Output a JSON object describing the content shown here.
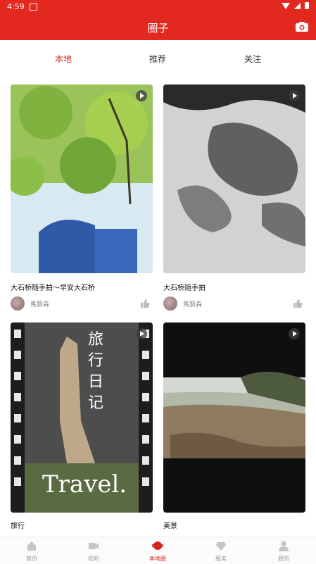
{
  "status": {
    "time": "4:59"
  },
  "appbar": {
    "title": "圈子",
    "camera_icon": "camera-icon"
  },
  "tabs": [
    {
      "label": "本地",
      "active": true
    },
    {
      "label": "推荐",
      "active": false
    },
    {
      "label": "关注",
      "active": false
    }
  ],
  "feed": [
    {
      "title": "大石桥随手拍～早安大石桥",
      "author": "馬賢森"
    },
    {
      "title": "大石桥随手拍",
      "author": "馬賢森"
    },
    {
      "title": "旅行",
      "overlay": "旅 行 日 记",
      "overlay2": "Travel."
    },
    {
      "title": "美景"
    }
  ],
  "bottom_nav": [
    {
      "label": "首页",
      "icon": "home-icon"
    },
    {
      "label": "视听",
      "icon": "video-icon"
    },
    {
      "label": "本地圈",
      "icon": "planet-icon",
      "active": true
    },
    {
      "label": "服务",
      "icon": "diamond-icon"
    },
    {
      "label": "我的",
      "icon": "user-icon"
    }
  ],
  "colors": {
    "brand_red": "#e2281f"
  }
}
